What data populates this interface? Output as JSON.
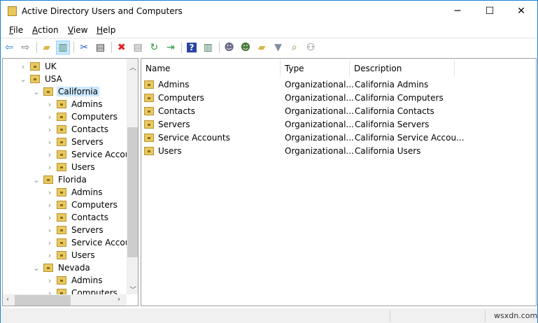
{
  "window": {
    "title": "Active Directory Users and Computers",
    "minimize": "─",
    "maximize": "☐",
    "close": "✕"
  },
  "menu": [
    {
      "label": "File",
      "key": "F",
      "rest": "ile"
    },
    {
      "label": "Action",
      "key": "A",
      "rest": "ction"
    },
    {
      "label": "View",
      "key": "V",
      "rest": "iew"
    },
    {
      "label": "Help",
      "key": "H",
      "rest": "elp"
    }
  ],
  "toolbar": [
    {
      "name": "back",
      "glyph": "⇦",
      "color": "#1e8ae0"
    },
    {
      "name": "forward",
      "glyph": "⇨",
      "color": "#777"
    },
    {
      "sep": true
    },
    {
      "name": "up-folder",
      "glyph": "▰",
      "color": "#d9b64a"
    },
    {
      "name": "show-hide-console-tree",
      "glyph": "▥",
      "color": "#4a8a6a",
      "active": true
    },
    {
      "sep": true
    },
    {
      "name": "cut",
      "glyph": "✂",
      "color": "#2060c0"
    },
    {
      "name": "copy",
      "glyph": "▤",
      "color": "#333"
    },
    {
      "sep": true
    },
    {
      "name": "delete",
      "glyph": "✖",
      "color": "#e02020"
    },
    {
      "name": "properties",
      "glyph": "▤",
      "color": "#888"
    },
    {
      "name": "refresh",
      "glyph": "↻",
      "color": "#2a9a3a"
    },
    {
      "name": "export-list",
      "glyph": "⇥",
      "color": "#2a9a3a"
    },
    {
      "sep": true
    },
    {
      "name": "help",
      "glyph": "?",
      "color": "#fff",
      "bg": "#2844a8"
    },
    {
      "name": "show-action-pane",
      "glyph": "▥",
      "color": "#3a7a5a"
    },
    {
      "sep": true
    },
    {
      "name": "new-user",
      "glyph": "☻",
      "color": "#6b6b8b"
    },
    {
      "name": "new-group",
      "glyph": "☻",
      "color": "#4a7a3a"
    },
    {
      "name": "new-ou",
      "glyph": "▰",
      "color": "#d9b64a"
    },
    {
      "name": "filter",
      "glyph": "▼",
      "color": "#8090a0"
    },
    {
      "name": "find",
      "glyph": "⌕",
      "color": "#a08030"
    },
    {
      "name": "add-to-group",
      "glyph": "⚇",
      "color": "#666"
    }
  ],
  "tree": [
    {
      "label": "UK",
      "level": 1,
      "expanded": false
    },
    {
      "label": "USA",
      "level": 1,
      "expanded": true
    },
    {
      "label": "California",
      "level": 2,
      "expanded": true,
      "selected": true
    },
    {
      "label": "Admins",
      "level": 3,
      "expanded": false
    },
    {
      "label": "Computers",
      "level": 3,
      "expanded": false
    },
    {
      "label": "Contacts",
      "level": 3,
      "expanded": false
    },
    {
      "label": "Servers",
      "level": 3,
      "expanded": false
    },
    {
      "label": "Service Accou",
      "level": 3,
      "expanded": false
    },
    {
      "label": "Users",
      "level": 3,
      "expanded": false
    },
    {
      "label": "Florida",
      "level": 2,
      "expanded": true
    },
    {
      "label": "Admins",
      "level": 3,
      "expanded": false
    },
    {
      "label": "Computers",
      "level": 3,
      "expanded": false
    },
    {
      "label": "Contacts",
      "level": 3,
      "expanded": false
    },
    {
      "label": "Servers",
      "level": 3,
      "expanded": false
    },
    {
      "label": "Service Accou",
      "level": 3,
      "expanded": false
    },
    {
      "label": "Users",
      "level": 3,
      "expanded": false
    },
    {
      "label": "Nevada",
      "level": 2,
      "expanded": true
    },
    {
      "label": "Admins",
      "level": 3,
      "expanded": false
    },
    {
      "label": "Computers",
      "level": 3,
      "expanded": false
    }
  ],
  "list": {
    "columns": [
      "Name",
      "Type",
      "Description"
    ],
    "rows": [
      [
        "Admins",
        "Organizational...",
        "California Admins"
      ],
      [
        "Computers",
        "Organizational...",
        "California Computers"
      ],
      [
        "Contacts",
        "Organizational...",
        "California Contacts"
      ],
      [
        "Servers",
        "Organizational...",
        "California Servers"
      ],
      [
        "Service Accounts",
        "Organizational...",
        "California Service Accou..."
      ],
      [
        "Users",
        "Organizational...",
        "California Users"
      ]
    ]
  },
  "status": {
    "watermark": "wsxdn.com"
  }
}
